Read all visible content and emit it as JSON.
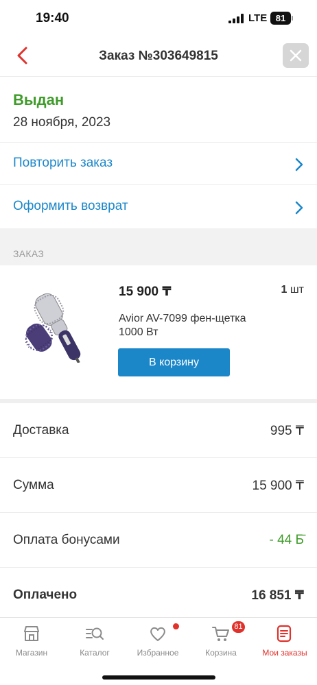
{
  "status_bar": {
    "time": "19:40",
    "network": "LTE",
    "battery": "81"
  },
  "header": {
    "title": "Заказ №303649815"
  },
  "order_status": {
    "label": "Выдан",
    "date": "28 ноября, 2023"
  },
  "actions": [
    {
      "label": "Повторить заказ"
    },
    {
      "label": "Оформить возврат"
    }
  ],
  "section": {
    "title": "ЗАКАЗ"
  },
  "product": {
    "price": "15 900 ₸",
    "qty_num": "1",
    "qty_unit": "шт",
    "name": "Avior AV-7099 фен-щетка 1000 Вт",
    "cart_button": "В корзину"
  },
  "summary": [
    {
      "label": "Доставка",
      "value": "995 ₸"
    },
    {
      "label": "Сумма",
      "value": "15 900 ₸"
    },
    {
      "label": "Оплата бонусами",
      "value": "- 44 Б̄"
    },
    {
      "label": "Оплачено",
      "value": "16 851 ₸"
    }
  ],
  "tabbar": {
    "items": [
      {
        "label": "Магазин",
        "icon": "shop-icon"
      },
      {
        "label": "Каталог",
        "icon": "catalog-search-icon"
      },
      {
        "label": "Избранное",
        "icon": "heart-icon"
      },
      {
        "label": "Корзина",
        "icon": "cart-icon",
        "badge": "81"
      },
      {
        "label": "Мои заказы",
        "icon": "orders-icon"
      }
    ]
  },
  "colors": {
    "accent_blue": "#1b87c9",
    "status_green": "#3f9b2a",
    "brand_red": "#e0312b"
  }
}
